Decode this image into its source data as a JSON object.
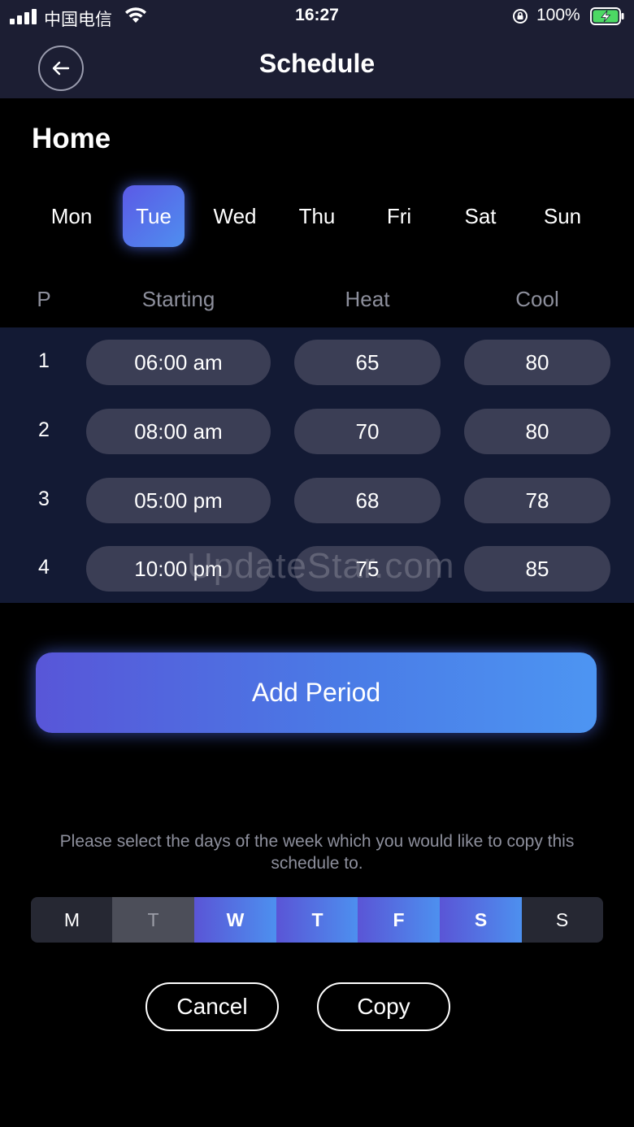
{
  "status_bar": {
    "carrier": "中国电信",
    "time": "16:27",
    "battery": "100%"
  },
  "nav": {
    "title": "Schedule",
    "back_icon": "arrow-left-icon"
  },
  "zone_title": "Home",
  "days": [
    {
      "label": "Mon",
      "active": false
    },
    {
      "label": "Tue",
      "active": true
    },
    {
      "label": "Wed",
      "active": false
    },
    {
      "label": "Thu",
      "active": false
    },
    {
      "label": "Fri",
      "active": false
    },
    {
      "label": "Sat",
      "active": false
    },
    {
      "label": "Sun",
      "active": false
    }
  ],
  "table": {
    "headers": {
      "period": "P",
      "starting": "Starting",
      "heat": "Heat",
      "cool": "Cool"
    },
    "rows": [
      {
        "p": "1",
        "start": "06:00 am",
        "heat": "65",
        "cool": "80"
      },
      {
        "p": "2",
        "start": "08:00 am",
        "heat": "70",
        "cool": "80"
      },
      {
        "p": "3",
        "start": "05:00 pm",
        "heat": "68",
        "cool": "78"
      },
      {
        "p": "4",
        "start": "10:00 pm",
        "heat": "75",
        "cool": "85"
      }
    ]
  },
  "watermark": "UpdateStar.com",
  "add_period_label": "Add Period",
  "copy_help": "Please select the days of the week which you would like to copy this schedule to.",
  "copy_days": [
    {
      "label": "M",
      "state": "unselected"
    },
    {
      "label": "T",
      "state": "current"
    },
    {
      "label": "W",
      "state": "selected"
    },
    {
      "label": "T",
      "state": "selected"
    },
    {
      "label": "F",
      "state": "selected"
    },
    {
      "label": "S",
      "state": "selected"
    },
    {
      "label": "S",
      "state": "unselected"
    }
  ],
  "buttons": {
    "cancel": "Cancel",
    "copy": "Copy"
  },
  "colors": {
    "nav_bg": "#1c1e33",
    "rows_bg": "#131a34",
    "pill_bg": "#3b3e55",
    "accent_start": "#5856d8",
    "accent_end": "#4d95f2",
    "battery_green": "#4cd964"
  }
}
